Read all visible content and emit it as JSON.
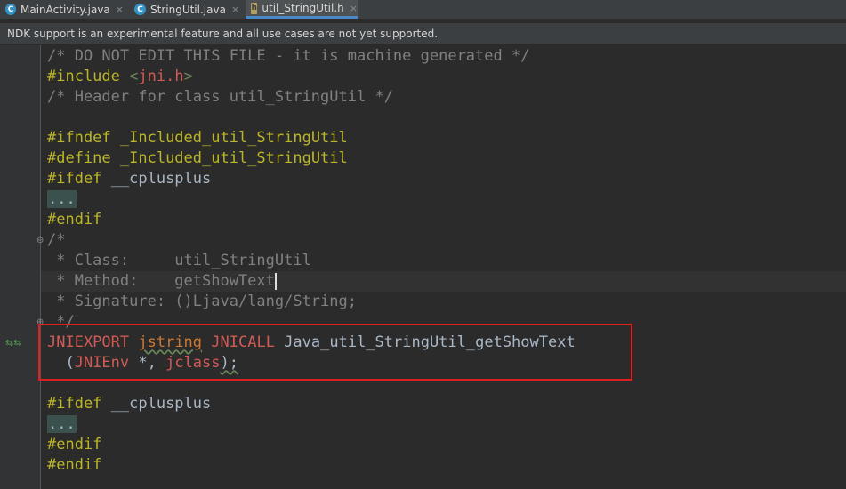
{
  "tabs": [
    {
      "label": "MainActivity.java",
      "icon": "C",
      "close": "×"
    },
    {
      "label": "StringUtil.java",
      "icon": "C",
      "close": "×"
    },
    {
      "label": "util_StringUtil.h",
      "icon": "h",
      "close": "×"
    }
  ],
  "notice": "NDK support is an experimental feature and all use cases are not yet supported.",
  "code": {
    "l1": "/* DO NOT EDIT THIS FILE - it is machine generated */",
    "l2_kw": "#include",
    "l2_sp": " ",
    "l2_lt": "<",
    "l2_str": "jni.h",
    "l2_gt": ">",
    "l3": "/* Header for class util_StringUtil */",
    "l5_kw": "#ifndef",
    "l5_name": " _Included_util_StringUtil",
    "l6_kw": "#define",
    "l6_name": " _Included_util_StringUtil",
    "l7_kw": "#ifdef",
    "l7_name": " __cplusplus",
    "l8": "...",
    "l9": "#endif",
    "l10": "/*",
    "l11": " * Class:     util_StringUtil",
    "l12": " * Method:    getShowText",
    "l13": " * Signature: ()Ljava/lang/String;",
    "l14": " */",
    "l15_a": "JNIEXPORT",
    "l15_b": "jstring",
    "l15_c": "JNICALL",
    "l15_d": "Java_util_StringUtil_getShowText",
    "l16_a": "  (",
    "l16_b": "JNIEnv",
    "l16_c": " *, ",
    "l16_d": "jclass",
    "l16_e": ");",
    "l18_kw": "#ifdef",
    "l18_name": " __cplusplus",
    "l19": "...",
    "l20": "#endif",
    "l21": "#endif"
  }
}
